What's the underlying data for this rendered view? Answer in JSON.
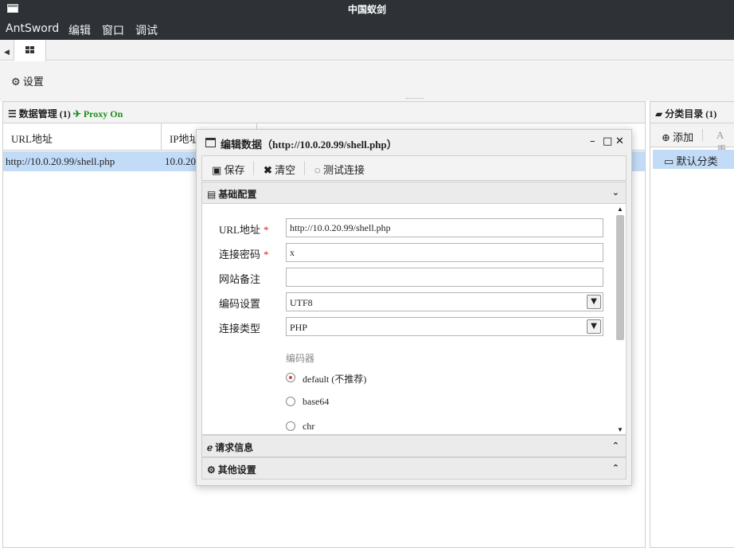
{
  "window": {
    "title": "中国蚁剑"
  },
  "menu": {
    "items": [
      "AntSword",
      "编辑",
      "窗口",
      "调试"
    ]
  },
  "toolbar": {
    "settings_label": "设置"
  },
  "data_panel": {
    "title": "数据管理 (1)",
    "proxy_status": "Proxy On",
    "columns": [
      "URL地址",
      "IP地址"
    ],
    "rows": [
      {
        "url": "http://10.0.20.99/shell.php",
        "ip": "10.0.20"
      }
    ]
  },
  "category_panel": {
    "title": "分类目录 (1)",
    "add_label": "添加",
    "rename_label": "重",
    "items": [
      "默认分类"
    ]
  },
  "dialog": {
    "title": "编辑数据（http://10.0.20.99/shell.php）",
    "save_label": "保存",
    "clear_label": "清空",
    "test_label": "测试连接",
    "sections": {
      "basic": "基础配置",
      "request": "请求信息",
      "other": "其他设置"
    },
    "form": {
      "url_label": "URL地址",
      "url_value": "http://10.0.20.99/shell.php",
      "password_label": "连接密码",
      "password_value": "x",
      "note_label": "网站备注",
      "note_value": "",
      "encoding_label": "编码设置",
      "encoding_value": "UTF8",
      "type_label": "连接类型",
      "type_value": "PHP",
      "required_mark": "*",
      "encoder_title": "编码器",
      "encoders": [
        {
          "label": "default (不推荐)",
          "selected": true
        },
        {
          "label": "base64",
          "selected": false
        },
        {
          "label": "chr",
          "selected": false
        }
      ]
    }
  }
}
